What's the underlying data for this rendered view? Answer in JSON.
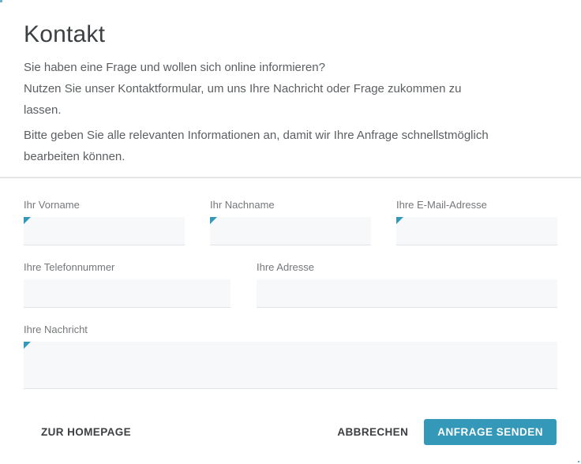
{
  "header": {
    "title": "Kontakt",
    "intro_lines": [
      "Sie haben eine Frage und wollen sich online informieren?",
      "Nutzen Sie unser Kontaktformular, um uns Ihre Nachricht oder Frage zukommen zu",
      "lassen."
    ],
    "note_lines": [
      "Bitte geben Sie alle relevanten Informationen an, damit wir Ihre Anfrage schnellstmöglich",
      "bearbeiten können."
    ]
  },
  "form": {
    "fields": [
      {
        "id": "first-name",
        "label": "Ihr Vorname",
        "value": "",
        "required": true
      },
      {
        "id": "last-name",
        "label": "Ihr Nachname",
        "value": "",
        "required": true
      },
      {
        "id": "email",
        "label": "Ihre E-Mail-Adresse",
        "value": "",
        "required": true
      },
      {
        "id": "phone",
        "label": "Ihre Telefonnummer",
        "value": "",
        "required": false
      },
      {
        "id": "address",
        "label": "Ihre Adresse",
        "value": "",
        "required": false
      },
      {
        "id": "message",
        "label": "Ihre Nachricht",
        "value": "",
        "required": true
      }
    ]
  },
  "actions": {
    "homepage": "ZUR HOMEPAGE",
    "cancel": "ABBRECHEN",
    "submit": "ANFRAGE SENDEN"
  },
  "colors": {
    "accent": "#3498b8"
  }
}
